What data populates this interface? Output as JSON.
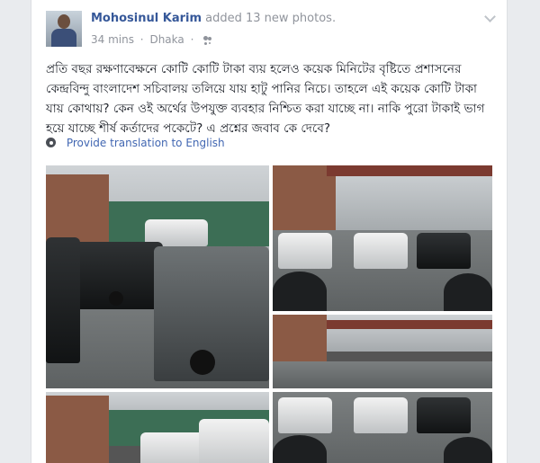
{
  "post": {
    "author": "Mohosinul Karim",
    "action": "added 13 new photos.",
    "time": "34 mins",
    "dot": "·",
    "location": "Dhaka",
    "audience_icon": "friends-icon",
    "text": "প্রতি বছর রক্ষণাবেক্ষনে কোটি কোটি টাকা ব্যয় হলেও কয়েক মিনিটের বৃষ্টিতে প্রশাসনের কেন্দ্রবিন্দু বাংলাদেশ সচিবালয় তলিয়ে যায় হাটু পানির নিচে। তাহলে এই কয়েক কোটি টাকা যায় কোথায়? কেন ওই অর্থের উপযুক্ত ব্যবহার নিশ্চিত করা যাচ্ছে না। নাকি পুরো টাকাই ভাগ হয়ে যাচ্ছে শীর্ষ কর্তাদের পকেটে? এ প্রশ্নের জবাব কে দেবে?",
    "translate_label": "Provide translation to English"
  },
  "colors": {
    "link": "#365899",
    "muted": "#90949c",
    "text": "#1d2129"
  }
}
